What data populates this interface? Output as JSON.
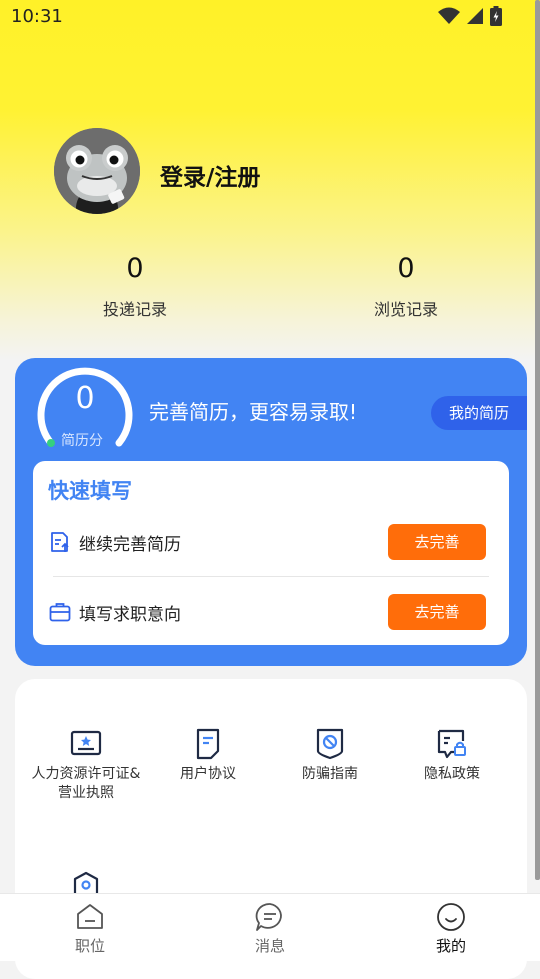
{
  "status_bar": {
    "time": "10:31"
  },
  "profile": {
    "login_label": "登录/注册"
  },
  "stats": [
    {
      "count": "0",
      "label": "投递记录"
    },
    {
      "count": "0",
      "label": "浏览记录"
    }
  ],
  "resume": {
    "score": "0",
    "score_label": "简历分",
    "slogan": "完善简历，更容易录取!",
    "my_resume_label": "我的简历",
    "quick_title": "快速填写",
    "rows": [
      {
        "label": "继续完善简历",
        "button": "去完善",
        "icon": "resume-edit-icon"
      },
      {
        "label": "填写求职意向",
        "button": "去完善",
        "icon": "briefcase-icon"
      }
    ]
  },
  "services": [
    {
      "label_line1": "人力资源许可证&",
      "label_line2": "营业执照",
      "icon": "license-icon"
    },
    {
      "label_line1": "用户协议",
      "label_line2": "",
      "icon": "agreement-icon"
    },
    {
      "label_line1": "防骗指南",
      "label_line2": "",
      "icon": "anti-fraud-icon"
    },
    {
      "label_line1": "隐私政策",
      "label_line2": "",
      "icon": "privacy-icon"
    }
  ],
  "bottom_nav": [
    {
      "label": "职位",
      "icon": "home-icon",
      "active": false
    },
    {
      "label": "消息",
      "icon": "message-icon",
      "active": false
    },
    {
      "label": "我的",
      "icon": "profile-icon",
      "active": true
    }
  ],
  "colors": {
    "primary_blue": "#4284f3",
    "accent_orange": "#ff6d0a",
    "header_yellow": "#fff128"
  }
}
